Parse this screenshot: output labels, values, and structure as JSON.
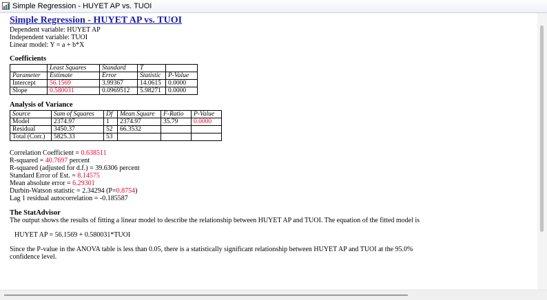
{
  "window": {
    "title": "Simple Regression - HUYET AP vs. TUOI"
  },
  "report": {
    "heading": "Simple Regression - HUYET AP vs. TUOI",
    "dependent": "Dependent variable: HUYET AP",
    "independent": "Independent variable: TUOI",
    "model": "Linear model: Y = a + b*X",
    "coefficients": {
      "title": "Coefficients",
      "header1": [
        "",
        "Least Squares",
        "Standard",
        "T",
        ""
      ],
      "header2": [
        "Parameter",
        "Estimate",
        "Error",
        "Statistic",
        "P-Value"
      ],
      "rows": [
        [
          "Intercept",
          "56.1569",
          "3.99367",
          "14.0615",
          "0.0000"
        ],
        [
          "Slope",
          "0.580031",
          "0.0969512",
          "5.98271",
          "0.0000"
        ]
      ]
    },
    "anova": {
      "title": "Analysis of Variance",
      "header": [
        "Source",
        "Sum of Squares",
        "Df",
        "Mean Square",
        "F-Ratio",
        "P-Value"
      ],
      "rows": [
        [
          "Model",
          "2374.97",
          "1",
          "2374.97",
          "35.79",
          "0.0000"
        ],
        [
          "Residual",
          "3450.37",
          "52",
          "66.3532",
          "",
          ""
        ],
        [
          "Total (Corr.)",
          "5825.33",
          "53",
          "",
          "",
          ""
        ]
      ]
    },
    "stats": {
      "corr_label": "Correlation Coefficient = ",
      "corr_value": "0.638511",
      "rsq_label": "R-squared = ",
      "rsq_value": "40.7697",
      "rsq_unit": " percent",
      "rsq_adj": "R-squared (adjusted for d.f.) = 39.6306 percent",
      "se_label": "Standard Error of Est. = ",
      "se_value": "8.14575",
      "mae_label": "Mean absolute error = ",
      "mae_value": "6.29301",
      "dw_label": "Durbin-Watson statistic = 2.34294 (P=",
      "dw_p": "0.8754",
      "dw_close": ")",
      "lag": "Lag 1 residual autocorrelation = -0.185587"
    },
    "advisor": {
      "title": "The StatAdvisor",
      "para1": "The output shows the results of fitting a linear model to describe the relationship between HUYET AP and TUOI.  The equation of the fitted model is",
      "equation": "HUYET AP = 56.1569 + 0.580031*TUOI",
      "para2a": "Since the P-value in the ANOVA table is less than 0.05, there is a statistically significant relationship between HUYET AP and TUOI at the 95.0%",
      "para2b": "confidence level."
    }
  }
}
